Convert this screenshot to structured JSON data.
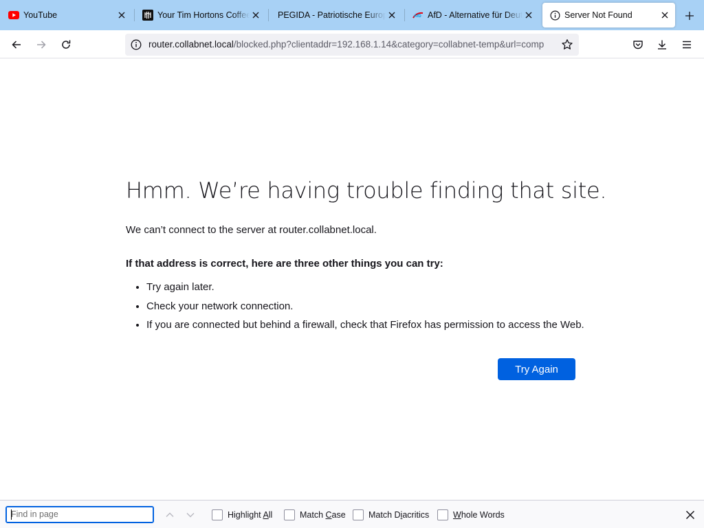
{
  "tabs": [
    {
      "title": "YouTube",
      "icon": "youtube-icon",
      "active": false
    },
    {
      "title": "Your Tim Hortons Coffee A",
      "icon": "tim-hortons-icon",
      "active": false
    },
    {
      "title": "PEGIDA - Patriotische Europäer",
      "icon": "none",
      "active": false
    },
    {
      "title": "AfD - Alternative für Deutschland",
      "icon": "afd-icon",
      "active": false
    },
    {
      "title": "Server Not Found",
      "icon": "info-icon",
      "active": true
    }
  ],
  "urlbar": {
    "url_host": "router.collabnet.local",
    "url_rest": "/blocked.php?clientaddr=192.168.1.14&category=collabnet-temp&url=comp"
  },
  "error": {
    "title": "Hmm. We’re having trouble finding that site.",
    "description": "We can’t connect to the server at router.collabnet.local.",
    "lead": "If that address is correct, here are three other things you can try:",
    "suggestions": [
      "Try again later.",
      "Check your network connection.",
      "If you are connected but behind a firewall, check that Firefox has permission to access the Web."
    ],
    "try_again_label": "Try Again"
  },
  "findbar": {
    "placeholder": "Find in page",
    "highlight_all": {
      "before": "Highlight ",
      "accel": "A",
      "after": "ll"
    },
    "match_case": {
      "before": "Match ",
      "accel": "C",
      "after": "ase"
    },
    "match_diacritics": {
      "before": "Match D",
      "accel": "i",
      "after": "acritics"
    },
    "whole_words": {
      "before": "",
      "accel": "W",
      "after": "hole Words"
    }
  },
  "colors": {
    "tabstrip": "#a8d1f5",
    "accent": "#0061e0",
    "youtube_red": "#ff0000",
    "text": "#15141a"
  }
}
